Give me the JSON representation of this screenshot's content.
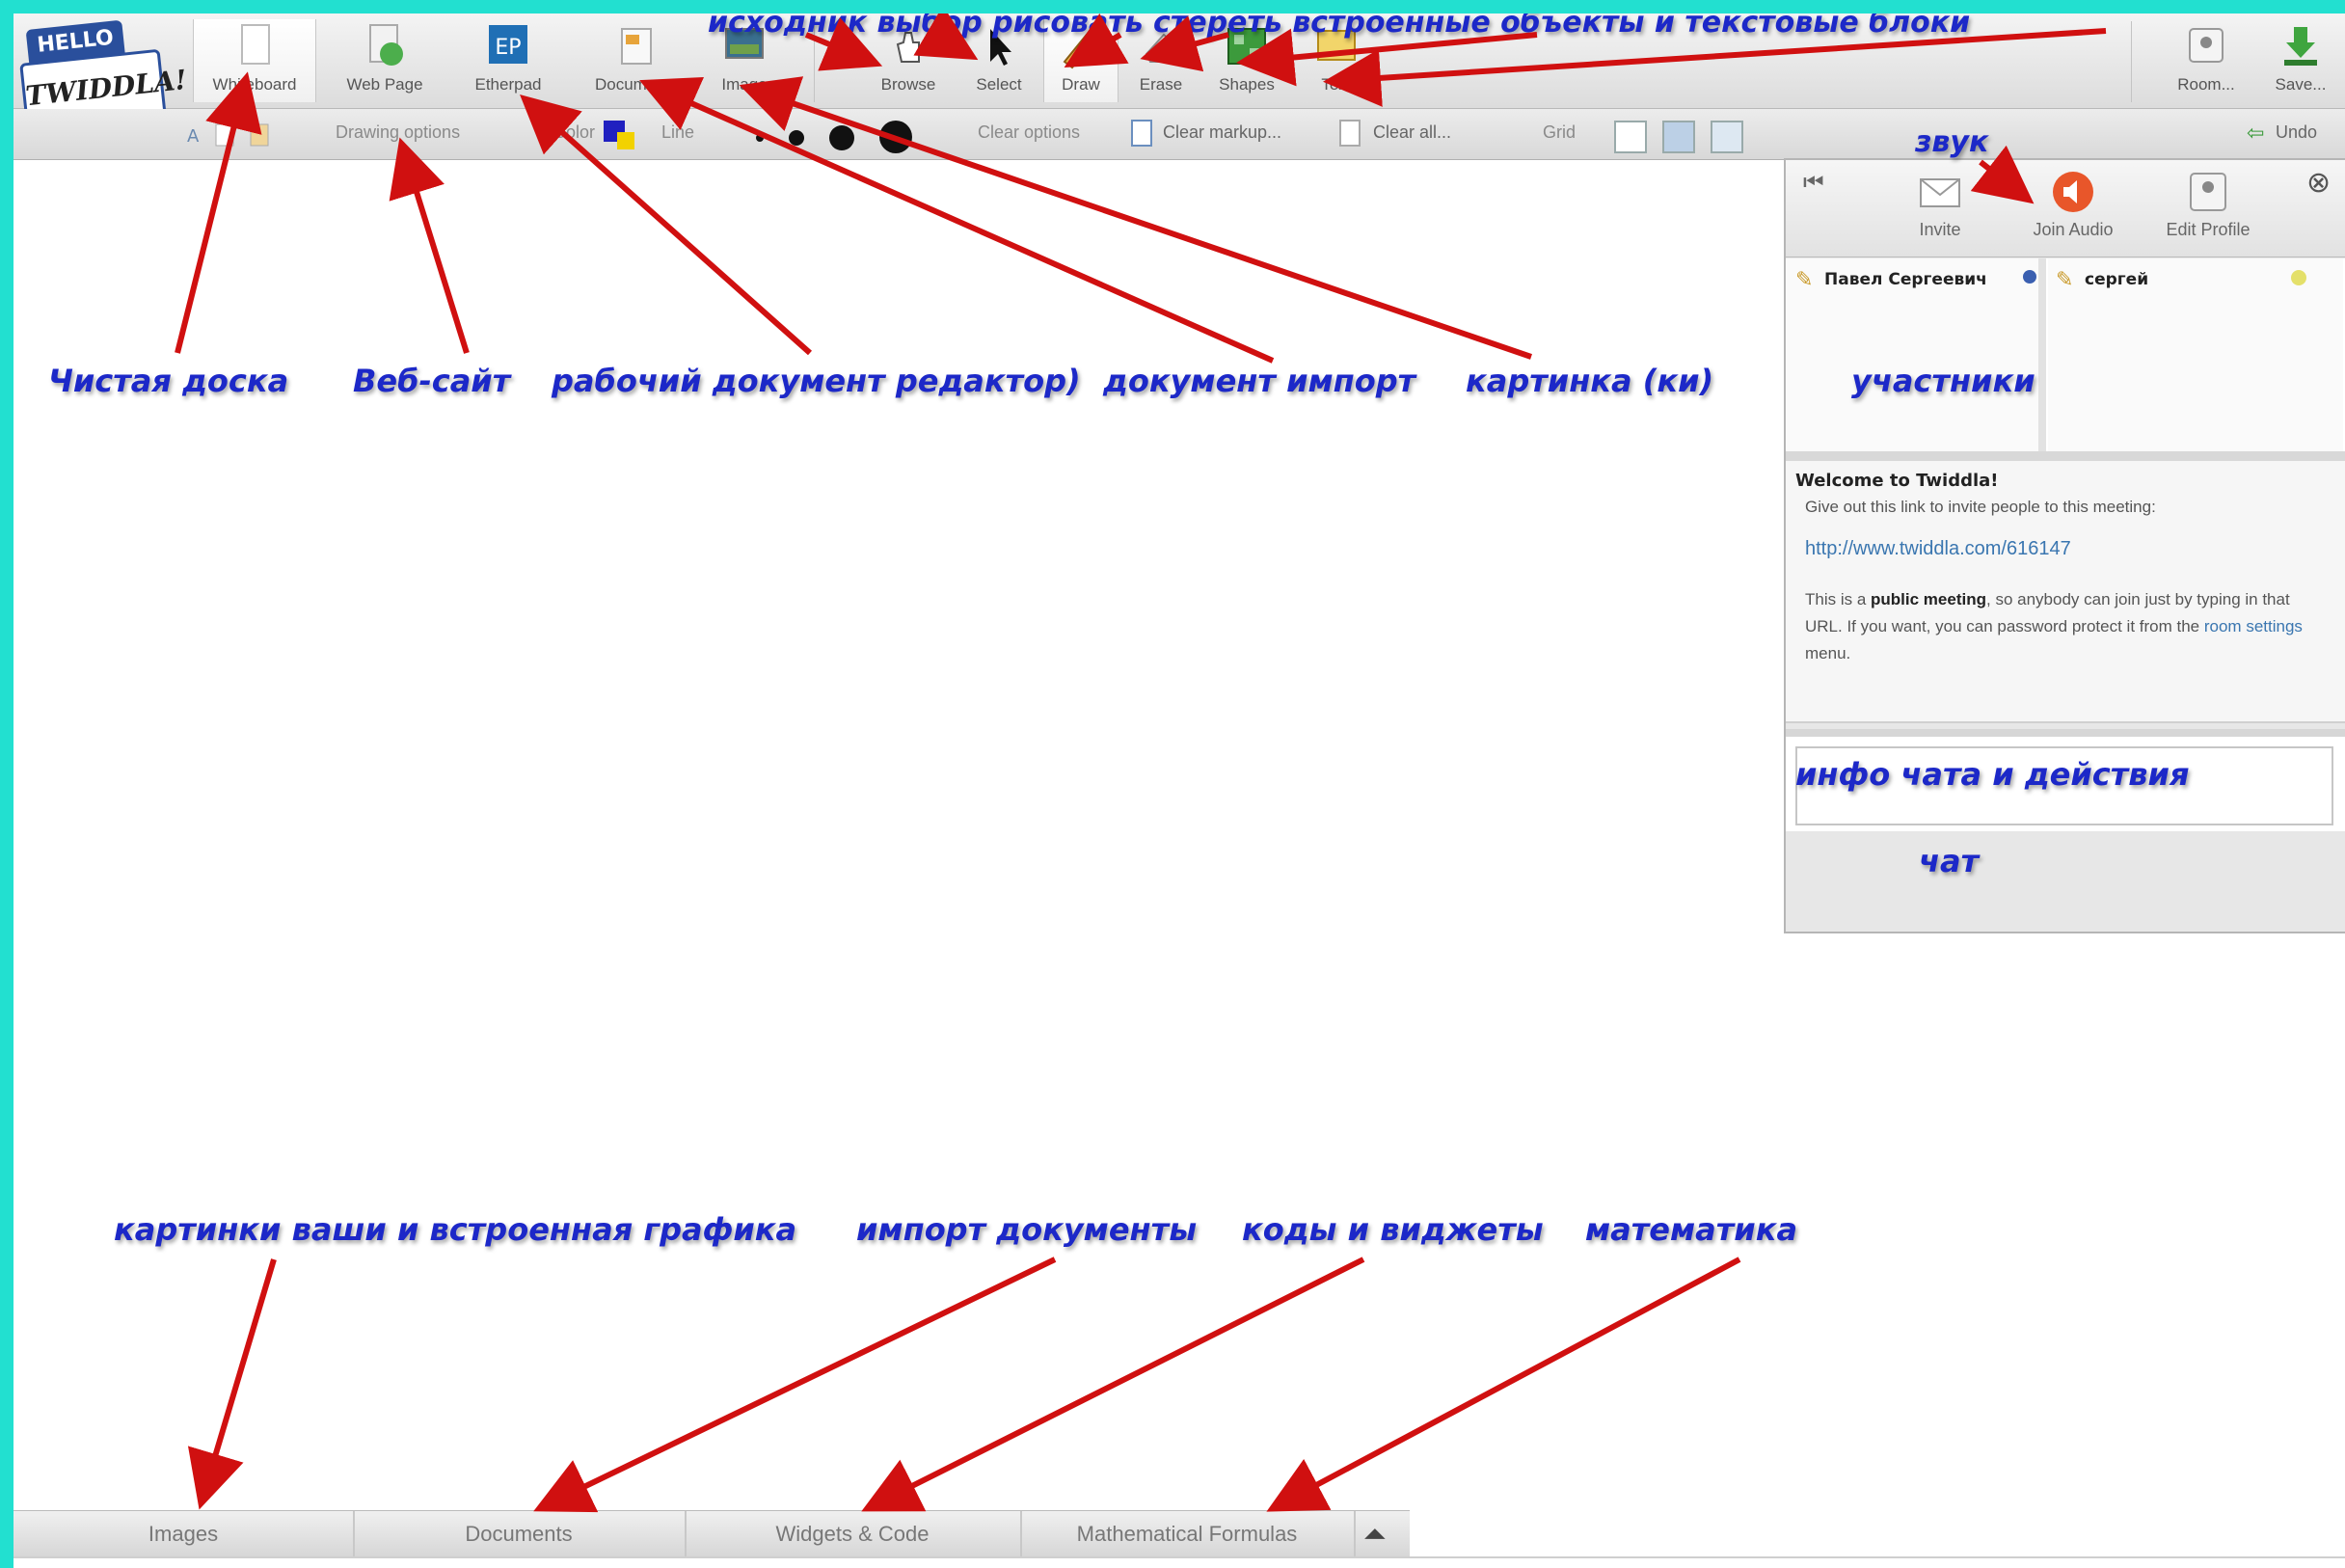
{
  "logo": {
    "top": "HELLO",
    "name": "TWIDDLA!"
  },
  "toolbar": {
    "whiteboard": "Whiteboard",
    "webpage": "Web Page",
    "etherpad": "Etherpad",
    "etherpad_icon": "EP",
    "documents": "Documents",
    "image": "Image",
    "browse": "Browse",
    "select": "Select",
    "draw": "Draw",
    "erase": "Erase",
    "shapes": "Shapes",
    "text": "Text",
    "room": "Room...",
    "save": "Save..."
  },
  "toolbar2": {
    "drawing_options": "Drawing options",
    "color": "Color",
    "line": "Line",
    "clear_options": "Clear options",
    "clear_markup": "Clear markup...",
    "clear_all": "Clear all...",
    "grid": "Grid",
    "undo": "Undo"
  },
  "side": {
    "invite": "Invite",
    "join_audio": "Join Audio",
    "edit_profile": "Edit Profile",
    "participant1": "Павел Сергеевич",
    "participant2": "сергей",
    "welcome_title": "Welcome to Twiddla!",
    "welcome_line": "Give out this link to invite people to this meeting:",
    "link": "http://www.twiddla.com/616147",
    "public_pre": "This is a ",
    "public_bold": "public meeting",
    "public_post": ", so anybody can join just by typing in that URL. If you want, you can password protect it from the ",
    "room_settings": "room settings",
    "menu_suffix": " menu."
  },
  "bottom_tabs": [
    "Images",
    "Documents",
    "Widgets & Code",
    "Mathematical Formulas"
  ],
  "annotations": {
    "top_tools": "исходник  выбор    рисовать    стереть  встроенные объекты  и текстовые блоки",
    "sound": "звук",
    "clean_board": "Чистая доска",
    "website": "Веб-сайт",
    "working_doc": "рабочий документ редактор)",
    "document_import": "документ импорт",
    "picture": "картинка (ки)",
    "participants": "участники",
    "chat_info": "инфо чата и действия",
    "chat": "чат",
    "bottom_images": "картинки ваши и встроенная графика",
    "bottom_docs": "импорт документы",
    "bottom_widgets": "коды и виджеты",
    "bottom_math": "математика"
  },
  "colors": {
    "background": "#22e0d0",
    "annotation": "#1c28c8",
    "arrow": "#d01010",
    "accent_color_swatch": "#2020c0"
  }
}
